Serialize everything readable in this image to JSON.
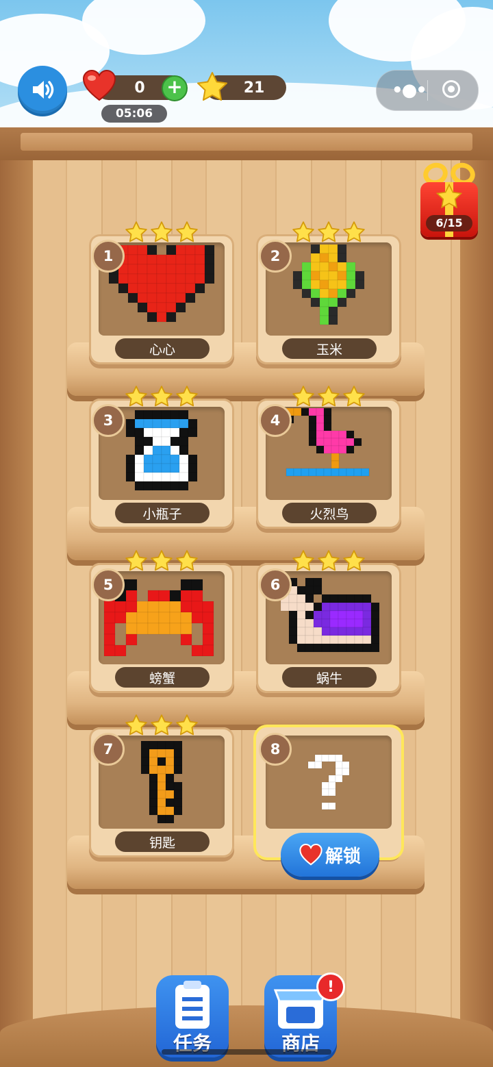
{
  "header": {
    "lives": "0",
    "timer": "05:06",
    "stars": "21",
    "gift_progress": "6/15"
  },
  "levels": [
    {
      "number": "1",
      "name": "心心",
      "stars": 3,
      "locked": false
    },
    {
      "number": "2",
      "name": "玉米",
      "stars": 3,
      "locked": false
    },
    {
      "number": "3",
      "name": "小瓶子",
      "stars": 3,
      "locked": false
    },
    {
      "number": "4",
      "name": "火烈鸟",
      "stars": 3,
      "locked": false
    },
    {
      "number": "5",
      "name": "螃蟹",
      "stars": 3,
      "locked": false
    },
    {
      "number": "6",
      "name": "蜗牛",
      "stars": 3,
      "locked": false
    },
    {
      "number": "7",
      "name": "钥匙",
      "stars": 3,
      "locked": false
    },
    {
      "number": "8",
      "name": "",
      "stars": 0,
      "locked": true
    }
  ],
  "unlock_label": "解锁",
  "bottom_nav": {
    "tasks_label": "任务",
    "shop_label": "商店",
    "shop_badge": "!"
  },
  "colors": {
    "heart": "#e82418",
    "corn_yellow": "#f6c318",
    "flamingo": "#ff3aa8",
    "crab_body": "#f7a21a",
    "snail_shell": "#7a2ae0",
    "key": "#f39c1a",
    "button_blue": "#2b8fe0"
  },
  "icons": {
    "sound": "speaker-icon",
    "lives": "heart-icon",
    "add": "plus-icon",
    "stars": "star-icon",
    "gift": "gift-icon",
    "menu": "more-dots-icon",
    "close": "target-circle-icon"
  }
}
